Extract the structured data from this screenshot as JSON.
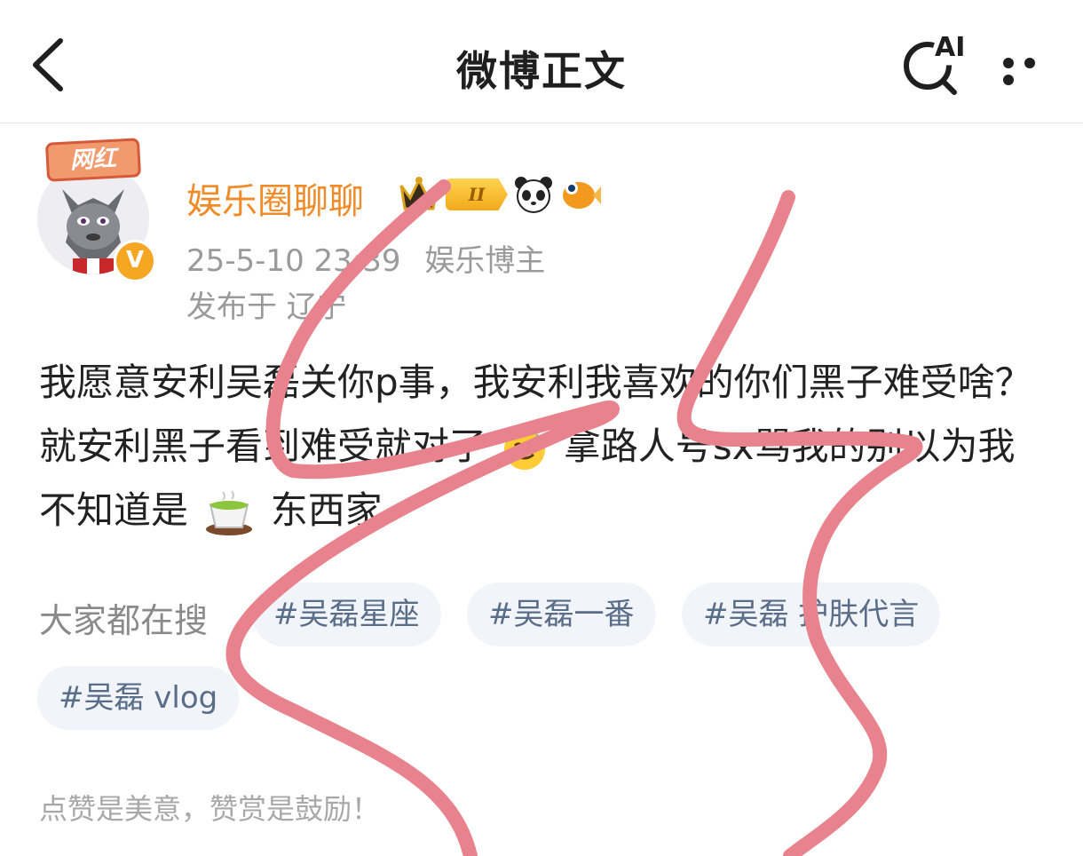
{
  "header": {
    "title": "微博正文",
    "ai_label": "AI",
    "back_icon": "chevron-left-icon",
    "more_icon": "more-dots-icon"
  },
  "author": {
    "avatar_badge": "网红",
    "verified_mark": "V",
    "name": "娱乐圈聊聊",
    "level": "II",
    "timestamp": "25-5-10 23:39",
    "category": "娱乐博主",
    "location": "发布于 辽宁"
  },
  "post": {
    "text_part1": "我愿意安利吴磊关你p事，我安利我喜欢的你们黑子难受啥？就安利黑子看到难受就对了",
    "text_part2": "拿路人号sx骂我的别以为我不知道是",
    "text_part3": "东西家"
  },
  "search": {
    "label": "大家都在搜",
    "tags": [
      "#吴磊星座",
      "#吴磊一番",
      "#吴磊 护肤代言",
      "#吴磊 vlog"
    ]
  },
  "footer": {
    "note": "点赞是美意，赞赏是鼓励！"
  },
  "colors": {
    "username": "#f08b2a",
    "tag_text": "#5a6d88",
    "scribble": "#e8828d"
  }
}
